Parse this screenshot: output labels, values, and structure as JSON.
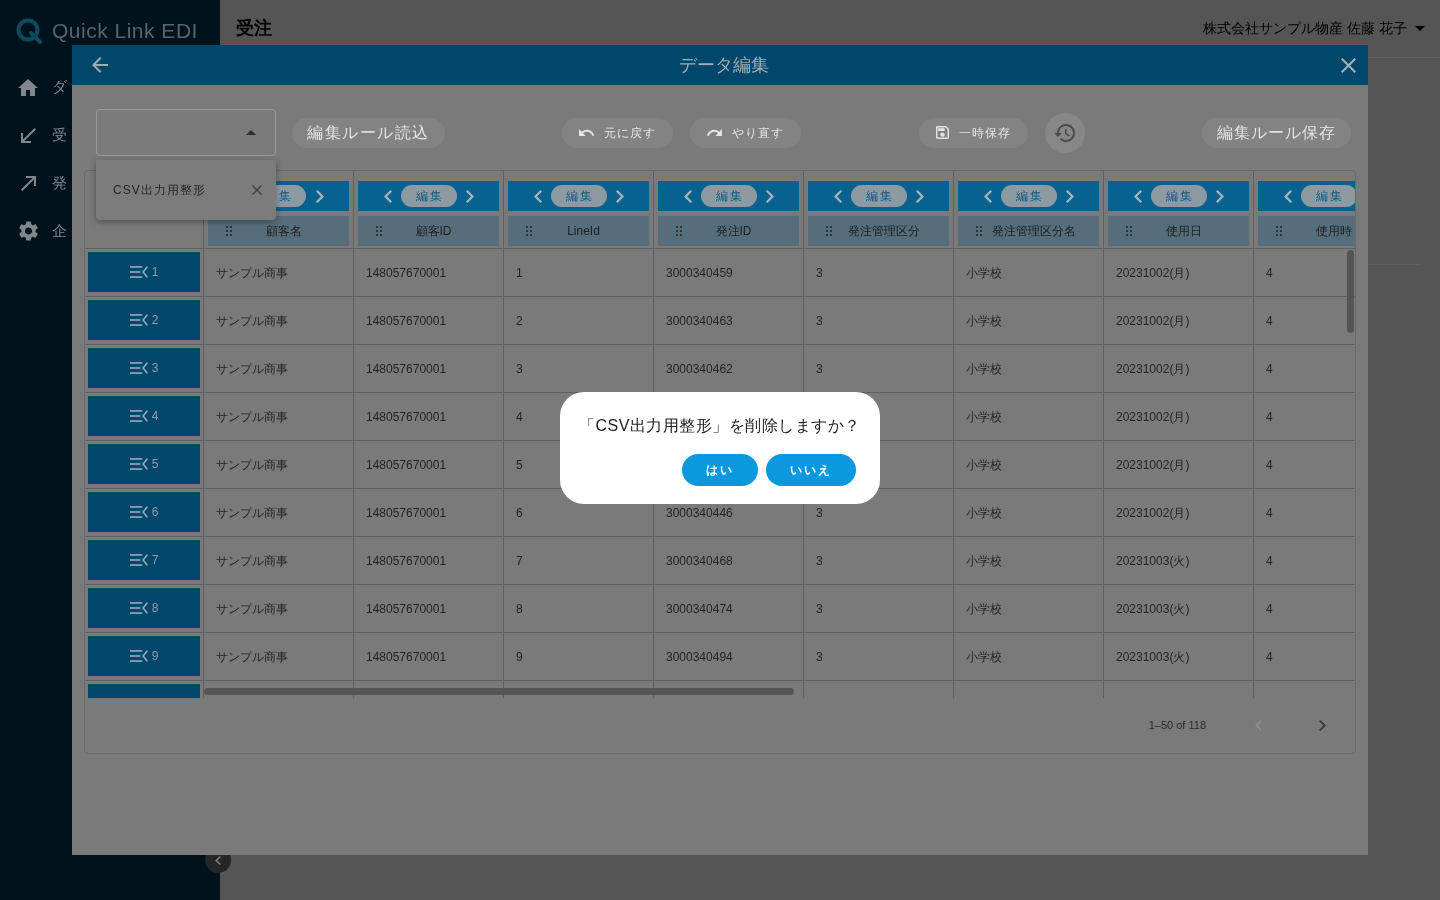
{
  "sidebar": {
    "logo": "Quick Link EDI",
    "items": [
      {
        "label": "ダ"
      },
      {
        "label": "受"
      },
      {
        "label": "発"
      },
      {
        "label": "企"
      }
    ]
  },
  "header": {
    "title": "受注",
    "user": "株式会社サンプル物産 佐藤 花子"
  },
  "modal": {
    "title": "データ編集",
    "toolbar": {
      "rule_select": {
        "expanded": true,
        "options": [
          {
            "label": "CSV出力用整形"
          }
        ]
      },
      "load_rule": {
        "label": "編集ルール読込",
        "disabled": true
      },
      "undo": {
        "label": "元に戻す",
        "disabled": true
      },
      "redo": {
        "label": "やり直す",
        "disabled": true
      },
      "temp_save": {
        "label": "一時保存",
        "disabled": true
      },
      "history": {
        "disabled": false
      },
      "save_rule": {
        "label": "編集ルール保存",
        "disabled": true
      }
    },
    "table": {
      "columns": [
        {
          "label": "顧客名",
          "edit": "集",
          "prev": false,
          "next": true
        },
        {
          "label": "顧客ID",
          "edit": "編集",
          "prev": true,
          "next": true
        },
        {
          "label": "LineId",
          "edit": "編集",
          "prev": true,
          "next": true
        },
        {
          "label": "発注ID",
          "edit": "編集",
          "prev": true,
          "next": true
        },
        {
          "label": "発注管理区分",
          "edit": "編集",
          "prev": true,
          "next": true
        },
        {
          "label": "発注管理区分名",
          "edit": "編集",
          "prev": true,
          "next": true
        },
        {
          "label": "使用日",
          "edit": "編集",
          "prev": true,
          "next": true
        },
        {
          "label": "使用時",
          "edit": "編集",
          "prev": true,
          "next": false
        }
      ],
      "rows": [
        {
          "number": "1",
          "cells": [
            "サンプル商事",
            "148057670001",
            "1",
            "3000340459",
            "3",
            "小学校",
            "20231002(月)",
            "4"
          ]
        },
        {
          "number": "2",
          "cells": [
            "サンプル商事",
            "148057670001",
            "2",
            "3000340463",
            "3",
            "小学校",
            "20231002(月)",
            "4"
          ]
        },
        {
          "number": "3",
          "cells": [
            "サンプル商事",
            "148057670001",
            "3",
            "3000340462",
            "3",
            "小学校",
            "20231002(月)",
            "4"
          ]
        },
        {
          "number": "4",
          "cells": [
            "サンプル商事",
            "148057670001",
            "4",
            null,
            null,
            "小学校",
            "20231002(月)",
            "4"
          ]
        },
        {
          "number": "5",
          "cells": [
            "サンプル商事",
            "148057670001",
            "5",
            null,
            null,
            "小学校",
            "20231002(月)",
            "4"
          ]
        },
        {
          "number": "6",
          "cells": [
            "サンプル商事",
            "148057670001",
            "6",
            "3000340446",
            "3",
            "小学校",
            "20231002(月)",
            "4"
          ]
        },
        {
          "number": "7",
          "cells": [
            "サンプル商事",
            "148057670001",
            "7",
            "3000340468",
            "3",
            "小学校",
            "20231003(火)",
            "4"
          ]
        },
        {
          "number": "8",
          "cells": [
            "サンプル商事",
            "148057670001",
            "8",
            "3000340474",
            "3",
            "小学校",
            "20231003(火)",
            "4"
          ]
        },
        {
          "number": "9",
          "cells": [
            "サンプル商事",
            "148057670001",
            "9",
            "3000340494",
            "3",
            "小学校",
            "20231003(火)",
            "4"
          ]
        }
      ]
    },
    "pagination": {
      "range": "1–50 of 118",
      "prev": {
        "disabled": true
      },
      "next": {
        "disabled": false
      }
    }
  },
  "confirm_dialog": {
    "message": "「CSV出力用整形」を削除しますか？",
    "buttons": [
      {
        "label": "はい"
      },
      {
        "label": "いいえ"
      }
    ]
  }
}
